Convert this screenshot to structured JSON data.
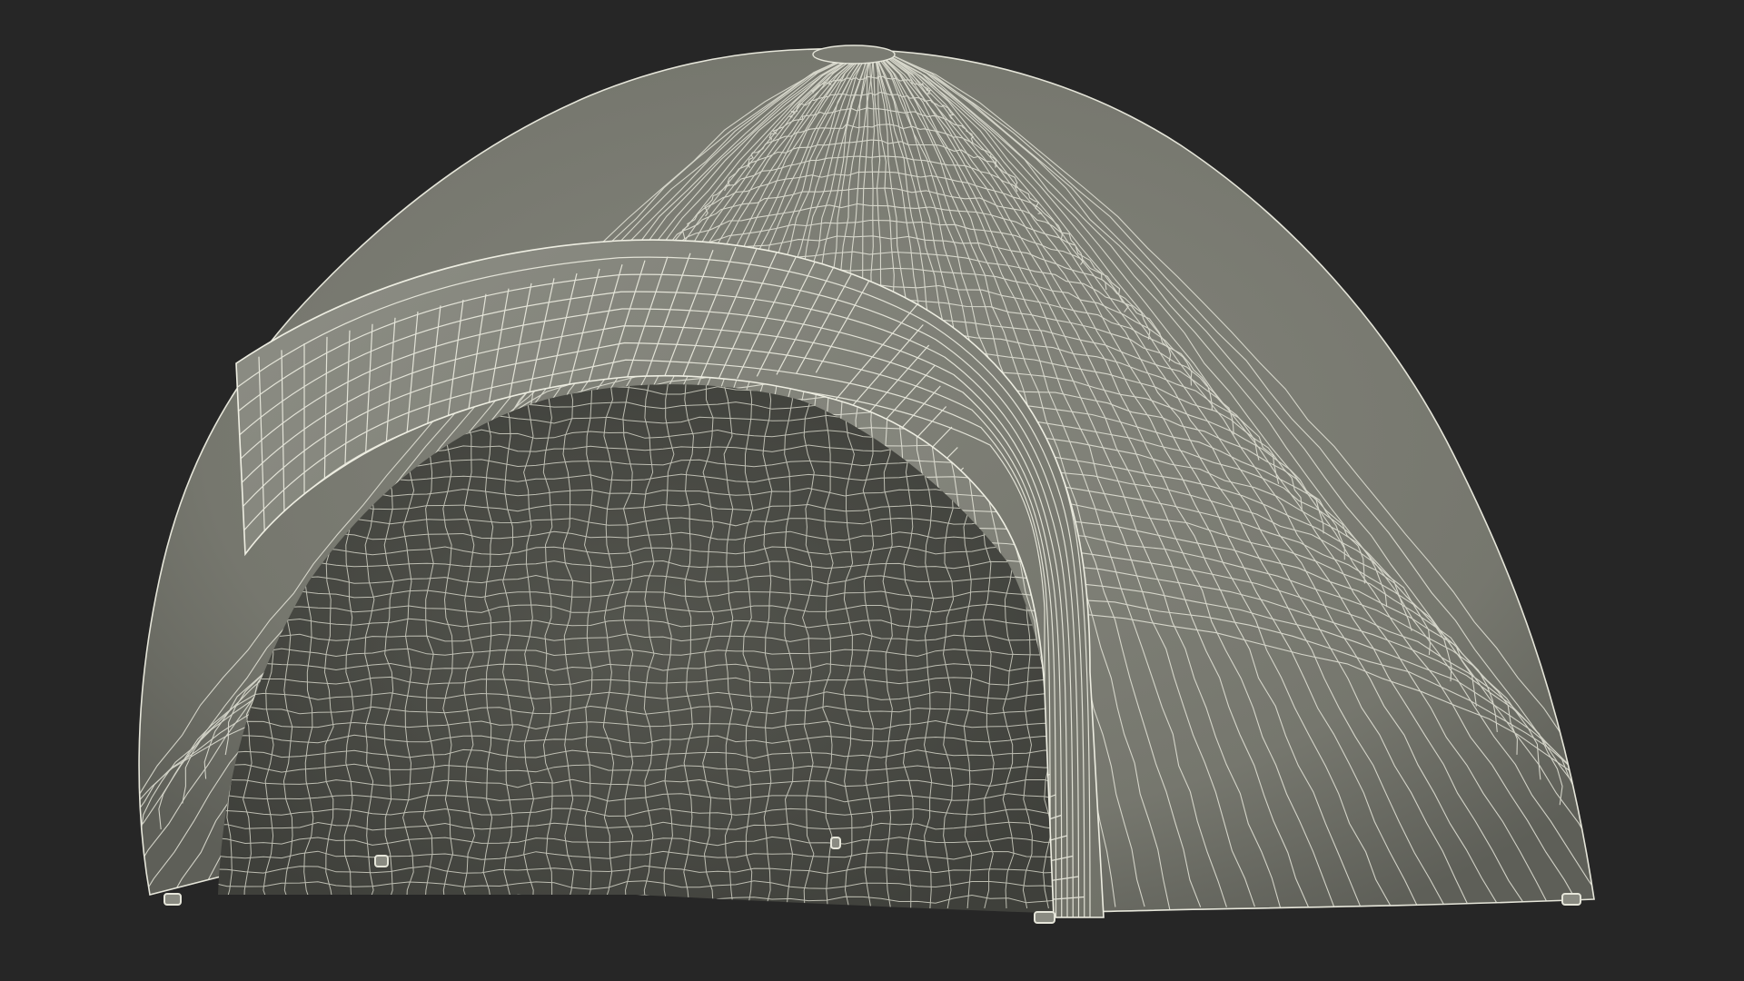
{
  "scene": {
    "subject": "inflatable-dome-tent-wireframe",
    "colors": {
      "background": "#262626",
      "shell": "#7c7d74",
      "shell_dark": "#5f605a",
      "interior": "#4f504b",
      "interior_deep": "#44453f",
      "arch": "#8a8b82",
      "wire": "#e8e8dc"
    }
  }
}
